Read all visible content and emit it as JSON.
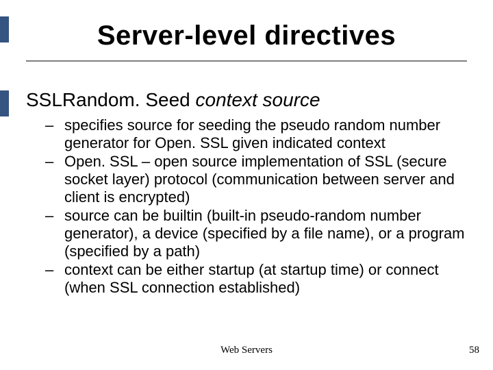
{
  "title": "Server-level directives",
  "heading": {
    "directive": "SSLRandom. Seed",
    "args": "context source"
  },
  "bullets": [
    "specifies source for seeding the pseudo random number generator for Open. SSL given indicated context",
    "Open. SSL – open source implementation of SSL (secure socket layer) protocol (communication between server and client is encrypted)",
    "source can be builtin (built-in pseudo-random number generator), a device (specified by a file name), or a program (specified by a path)",
    "context can be either startup (at startup time) or connect (when SSL connection established)"
  ],
  "footer": "Web Servers",
  "page_number": "58"
}
